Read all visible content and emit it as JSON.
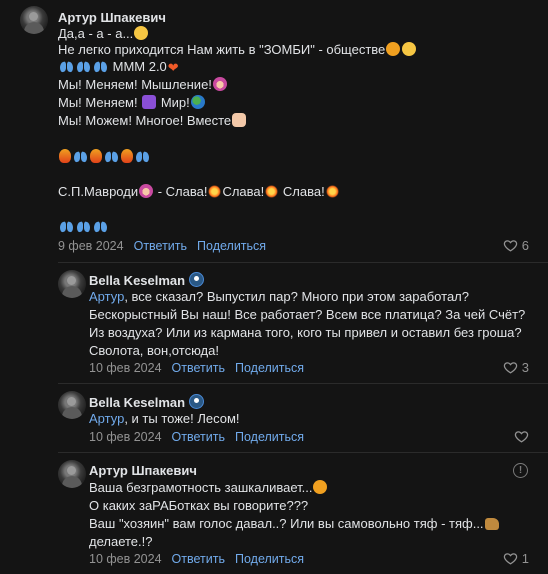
{
  "comments": [
    {
      "author": "Артур Шпакевич",
      "lines": [
        {
          "text": "Да,а - а - а...",
          "emoji": [
            "smirk-face-icon"
          ]
        },
        {
          "text": "Не легко приходится Нам жить в \"ЗОМБИ\" - обществе",
          "emoji": [
            "pointing-hand-icon",
            "thinking-face-icon"
          ]
        },
        {
          "prefix_emoji": [
            "butterfly-icon",
            "butterfly-icon",
            "butterfly-icon"
          ],
          "text": " МММ 2.0",
          "emoji": [
            "heart-icon"
          ]
        },
        {
          "text": "Мы! Меняем! Мышление!",
          "emoji": [
            "woman-icon"
          ]
        },
        {
          "text_a": "Мы! Меняем! ",
          "mid_emoji": "peace-icon",
          "text_b": " Мир!",
          "emoji": [
            "globe-icon"
          ]
        },
        {
          "text": "Мы! Можем! Многое! Вместе",
          "emoji": [
            "fist-icon"
          ]
        },
        {
          "text": "",
          "row_emoji": [
            "fire-icon",
            "butterfly-icon",
            "fire-icon",
            "butterfly-icon",
            "fire-icon",
            "butterfly-icon"
          ]
        },
        {
          "text_parts": [
            "С.П.Мавроди",
            " - Слава!",
            "Слава!",
            " Слава!"
          ]
        },
        {
          "text": "",
          "row_emoji": [
            "butterfly-icon",
            "butterfly-icon",
            "butterfly-icon"
          ]
        }
      ],
      "date": "9 фев 2024",
      "reply_label": "Ответить",
      "share_label": "Поделиться",
      "likes": "6"
    },
    {
      "author": "Bella Keselman",
      "mention": "Артур",
      "lines": [
        ", все сказал? Выпустил пар? Много при этом заработал?",
        "Бескорыстный Вы наш! Все работает? Всем все платица? За чей Счёт?",
        "Из воздуха? Или из кармана того, кого ты привел и оставил без гроша?",
        "Сволота, вон,отсюда!"
      ],
      "date": "10 фев 2024",
      "reply_label": "Ответить",
      "share_label": "Поделиться",
      "likes": "3"
    },
    {
      "author": "Bella Keselman",
      "mention": "Артур",
      "lines": [
        ", и ты тоже! Лесом!"
      ],
      "date": "10 фев 2024",
      "reply_label": "Ответить",
      "share_label": "Поделиться"
    },
    {
      "author": "Артур Шпакевич",
      "lines": [
        "Ваша безграмотность зашкаливает...",
        "О каких заРАБотках вы говорите???",
        "Ваш \"хозяин\" вам голос давал..? Или вы самовольно тяф - тяф...",
        "делаете.!?"
      ],
      "date": "10 фев 2024",
      "reply_label": "Ответить",
      "share_label": "Поделиться",
      "likes": "1"
    }
  ],
  "colors": {
    "background": "#141414",
    "text": "#e1e3e6",
    "link": "#71aaeb",
    "secondary": "#939393"
  }
}
